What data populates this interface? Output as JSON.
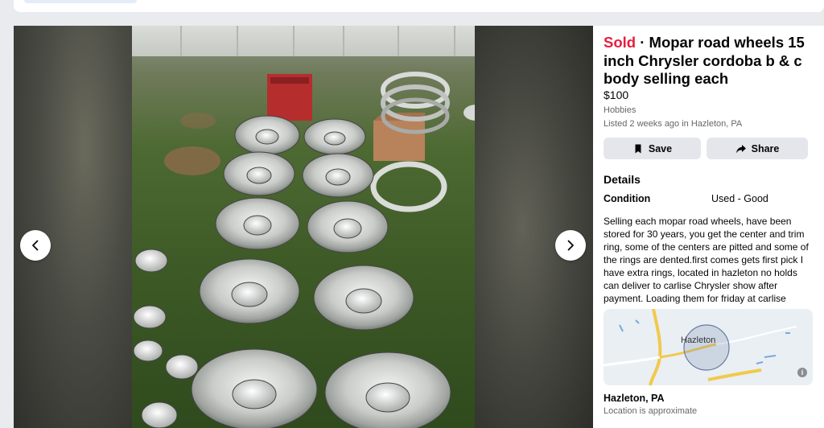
{
  "listing": {
    "sold_label": "Sold",
    "title": "Mopar road wheels 15 inch Chrysler cordoba b & c body selling each",
    "price": "$100",
    "category": "Hobbies",
    "listed": "Listed 2 weeks ago in Hazleton, PA"
  },
  "actions": {
    "save_label": "Save",
    "share_label": "Share"
  },
  "details": {
    "heading": "Details",
    "condition_label": "Condition",
    "condition_value": "Used - Good",
    "description": "Selling each mopar road wheels, have been stored for 30 years, you get the center and trim ring, some of the centers are pitted and some of the rings are dented.first comes gets first pick I have extra rings, located in hazleton no holds can deliver to carlise Chrysler show after payment. Loading them for friday at carlise"
  },
  "map": {
    "city_label": "Hazleton",
    "info_glyph": "i"
  },
  "location": {
    "name": "Hazleton, PA",
    "note": "Location is approximate"
  },
  "viewer": {
    "prev_icon": "chevron-left-icon",
    "next_icon": "chevron-right-icon"
  },
  "colors": {
    "sold": "#e41e3f",
    "button_bg": "#e4e6eb",
    "secondary_text": "#65676b"
  }
}
